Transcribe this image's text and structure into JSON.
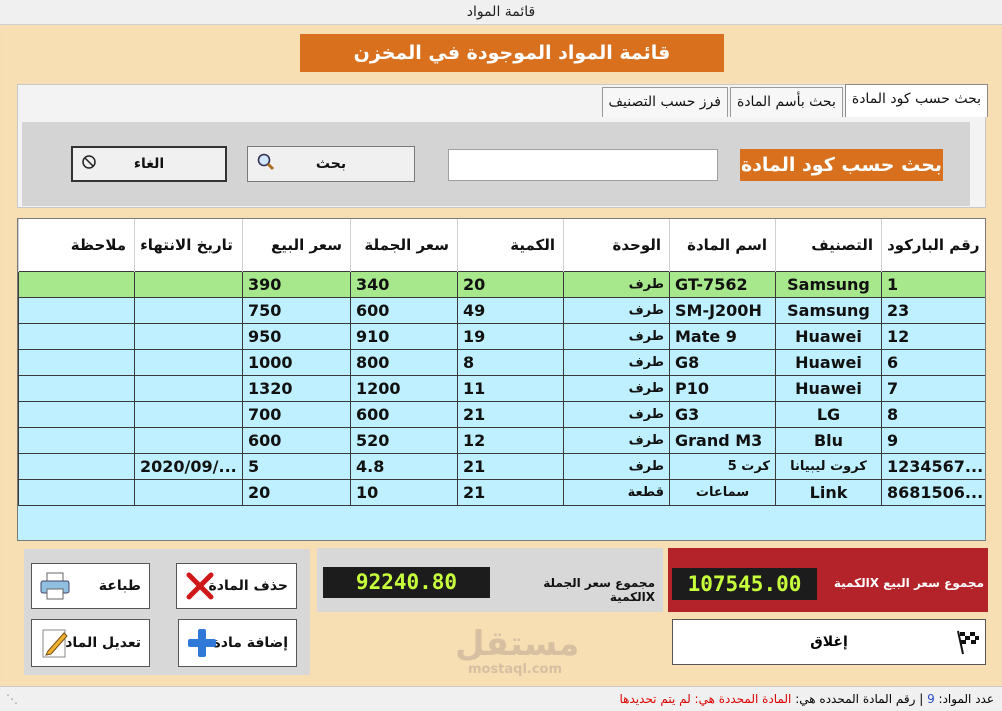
{
  "window": {
    "title": "قائمة المواد"
  },
  "header": {
    "banner": "قائمة المواد الموجودة في  المخزن"
  },
  "tabs": [
    {
      "label": "بحث حسب كود المادة",
      "active": true
    },
    {
      "label": "بحث بأسم المادة",
      "active": false
    },
    {
      "label": "فرز حسب التصنيف",
      "active": false
    }
  ],
  "search": {
    "label": "بحث حسب كود المادة",
    "input_value": "",
    "search_button": "بحث",
    "cancel_button": "الغاء"
  },
  "table": {
    "columns": [
      "رقم الباركود",
      "التصنيف",
      "اسم المادة",
      "الوحدة",
      "الكمية",
      "سعر الجملة",
      "سعر البيع",
      "تاريخ الانتهاء",
      "ملاحظة"
    ],
    "rows": [
      {
        "barcode": "1",
        "category": "Samsung",
        "name": "GT-7562",
        "unit": "طرف",
        "qty": "20",
        "wholesale": "340",
        "retail": "390",
        "expiry": "",
        "note": ""
      },
      {
        "barcode": "23",
        "category": "Samsung",
        "name": "SM-J200H",
        "unit": "طرف",
        "qty": "49",
        "wholesale": "600",
        "retail": "750",
        "expiry": "",
        "note": ""
      },
      {
        "barcode": "12",
        "category": "Huawei",
        "name": "Mate 9",
        "unit": "طرف",
        "qty": "19",
        "wholesale": "910",
        "retail": "950",
        "expiry": "",
        "note": ""
      },
      {
        "barcode": "6",
        "category": "Huawei",
        "name": "G8",
        "unit": "طرف",
        "qty": "8",
        "wholesale": "800",
        "retail": "1000",
        "expiry": "",
        "note": ""
      },
      {
        "barcode": "7",
        "category": "Huawei",
        "name": "P10",
        "unit": "طرف",
        "qty": "11",
        "wholesale": "1200",
        "retail": "1320",
        "expiry": "",
        "note": ""
      },
      {
        "barcode": "8",
        "category": "LG",
        "name": "G3",
        "unit": "طرف",
        "qty": "21",
        "wholesale": "600",
        "retail": "700",
        "expiry": "",
        "note": ""
      },
      {
        "barcode": "9",
        "category": "Blu",
        "name": "Grand M3",
        "unit": "طرف",
        "qty": "12",
        "wholesale": "520",
        "retail": "600",
        "expiry": "",
        "note": ""
      },
      {
        "barcode": "1234567...",
        "category": "كروت ليبيانا",
        "name": "كرت 5",
        "unit": "طرف",
        "qty": "21",
        "wholesale": "4.8",
        "retail": "5",
        "expiry": "2020/09/...",
        "note": ""
      },
      {
        "barcode": "8681506...",
        "category": "Link",
        "name": "سماعات",
        "unit": "قطعة",
        "qty": "21",
        "wholesale": "10",
        "retail": "20",
        "expiry": "",
        "note": ""
      }
    ]
  },
  "actions": {
    "delete": "حذف المادة",
    "print": "طباعة",
    "add": "إضافة مادة",
    "edit": "تعديل المادة"
  },
  "totals": {
    "wholesale_label": "مجموع سعر الجملة Xالكمية",
    "wholesale_value": "92240.80",
    "retail_label": "مجموع سعر البيع Xالكمية",
    "retail_value": "107545.00"
  },
  "close_button": "إغلاق",
  "status": {
    "count_label": "عدد المواد:",
    "count_value": "9",
    "selected_label": "رقم المادة المحدده هي:",
    "selected_text": "المادة المحددة هي: لم يتم تحديدها"
  },
  "watermark": {
    "line1": "مستقل",
    "line2": "mostaql.com"
  },
  "colors": {
    "accent": "#d8701e",
    "grid_row": "#bff0ff",
    "selected_row": "#a8e88c",
    "retail_panel": "#b5232a",
    "display_text": "#c8ff3c"
  }
}
